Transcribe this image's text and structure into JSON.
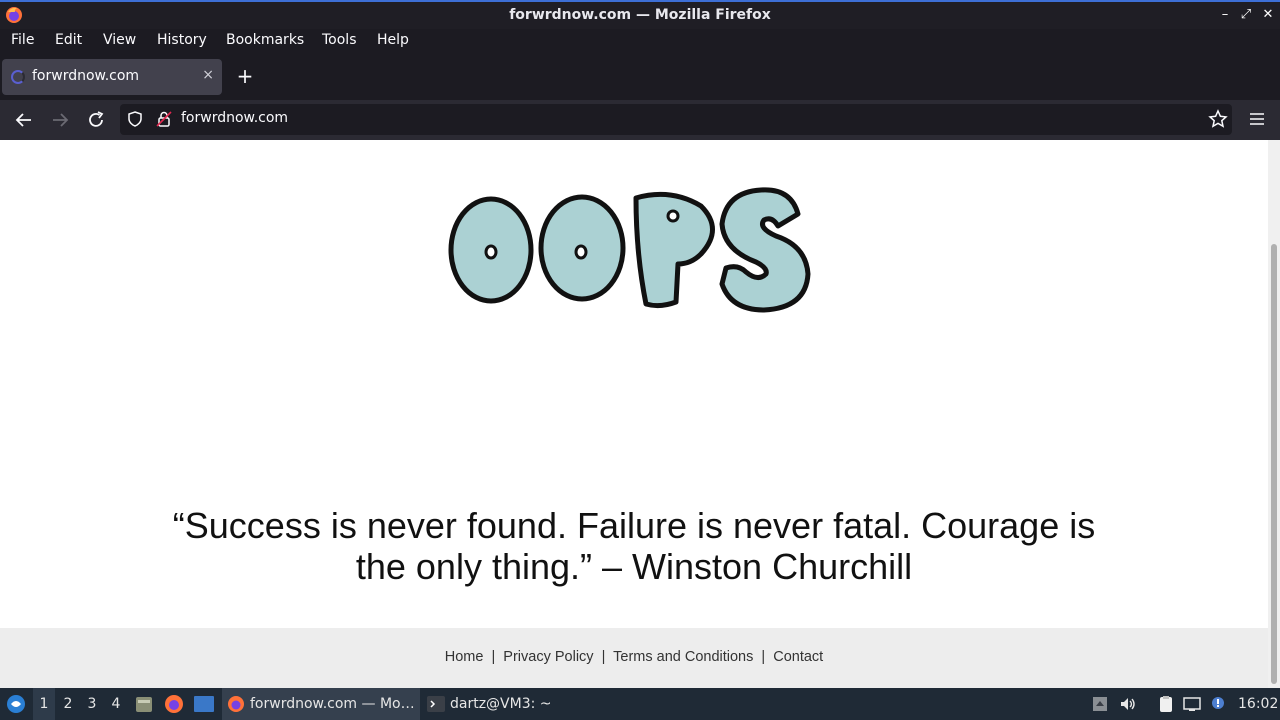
{
  "window": {
    "title": "forwrdnow.com — Mozilla Firefox"
  },
  "menubar": {
    "items": [
      "File",
      "Edit",
      "View",
      "History",
      "Bookmarks",
      "Tools",
      "Help"
    ]
  },
  "tabs": [
    {
      "label": "forwrdnow.com",
      "close": "×"
    }
  ],
  "newtab_label": "+",
  "urlbar": {
    "url": "forwrdnow.com"
  },
  "page": {
    "heading_image_alt": "OOPS",
    "quote_line1": "“Success is never found. Failure is never fatal. Courage is",
    "quote_line2": "the only thing.” – Winston Churchill",
    "footer_links": [
      "Home",
      "Privacy Policy",
      "Terms and Conditions",
      "Contact"
    ],
    "footer_separator": "|"
  },
  "taskbar": {
    "workspaces": [
      "1",
      "2",
      "3",
      "4"
    ],
    "active_workspace": "1",
    "tasks": [
      {
        "label": "forwrdnow.com — Mo…",
        "icon": "firefox-icon"
      },
      {
        "label": "dartz@VM3: ~",
        "icon": "terminal-icon"
      }
    ],
    "clock": "16:02"
  },
  "colors": {
    "accent": "#3d6fd6",
    "oops_fill": "#abd1d3"
  }
}
